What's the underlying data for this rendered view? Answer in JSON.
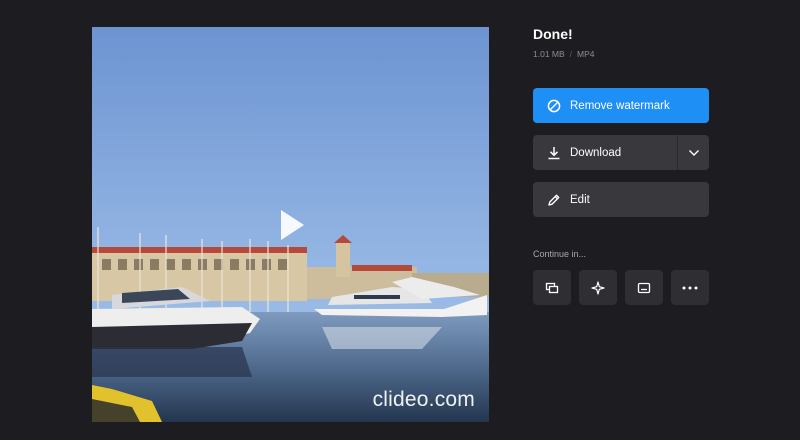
{
  "preview": {
    "watermark": "clideo.com",
    "play_icon": "play-icon"
  },
  "panel": {
    "title": "Done!",
    "file_size": "1.01 MB",
    "separator": "/",
    "file_format": "MP4"
  },
  "actions": {
    "remove_watermark": {
      "label": "Remove watermark",
      "icon": "no-entry-icon",
      "color": "#1e8ff5"
    },
    "download": {
      "label": "Download",
      "icon": "download-icon",
      "dropdown_icon": "chevron-down-icon"
    },
    "edit": {
      "label": "Edit",
      "icon": "pencil-icon"
    }
  },
  "continue_in": {
    "label": "Continue in...",
    "tools": [
      {
        "icon": "layers-icon"
      },
      {
        "icon": "sparkle-icon"
      },
      {
        "icon": "subtitles-icon"
      },
      {
        "icon": "more-icon"
      }
    ]
  }
}
